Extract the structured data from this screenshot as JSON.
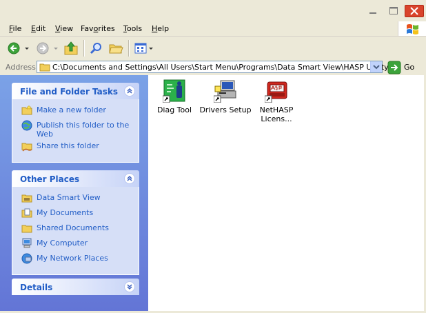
{
  "window": {
    "min_icon": "minimize-icon",
    "max_icon": "maximize-icon",
    "close_icon": "close-icon",
    "logo_icon": "windows-logo-icon"
  },
  "menu": {
    "items": [
      {
        "label": "File",
        "key": "F",
        "rest": "ile"
      },
      {
        "label": "Edit",
        "key": "E",
        "rest": "dit"
      },
      {
        "label": "View",
        "key": "V",
        "rest": "iew"
      },
      {
        "label": "Favorites",
        "key": "F",
        "rest": "avorites",
        "prefix": "Fav",
        "ukey": "o",
        "suffix": "rites"
      },
      {
        "label": "Tools",
        "key": "T",
        "rest": "ools"
      },
      {
        "label": "Help",
        "key": "H",
        "rest": "elp"
      }
    ]
  },
  "toolbar": {
    "back_icon": "back-arrow-icon",
    "forward_icon": "forward-arrow-icon",
    "up_icon": "up-folder-icon",
    "search_icon": "search-icon",
    "folders_icon": "folders-icon",
    "views_icon": "views-icon"
  },
  "address": {
    "label": "Address",
    "path": "C:\\Documents and Settings\\All Users\\Start Menu\\Programs\\Data Smart View\\HASP Utility",
    "go_label": "Go"
  },
  "panels": {
    "file_tasks": {
      "title": "File and Folder Tasks",
      "items": [
        {
          "label": "Make a new folder",
          "icon": "new-folder-icon"
        },
        {
          "label": "Publish this folder to the Web",
          "icon": "publish-web-icon"
        },
        {
          "label": "Share this folder",
          "icon": "share-folder-icon"
        }
      ]
    },
    "other_places": {
      "title": "Other Places",
      "items": [
        {
          "label": "Data Smart View",
          "icon": "folder-icon"
        },
        {
          "label": "My Documents",
          "icon": "my-documents-icon"
        },
        {
          "label": "Shared Documents",
          "icon": "shared-folder-icon"
        },
        {
          "label": "My Computer",
          "icon": "my-computer-icon"
        },
        {
          "label": "My Network Places",
          "icon": "network-places-icon"
        }
      ]
    },
    "details": {
      "title": "Details"
    }
  },
  "files": [
    {
      "label": "Diag Tool",
      "icon": "diag-tool-icon"
    },
    {
      "label": "Drivers Setup",
      "icon": "drivers-setup-icon"
    },
    {
      "label": "NetHASP Licens...",
      "line1": "NetHASP",
      "line2": "Licens...",
      "icon": "nethasp-icon"
    }
  ],
  "colors": {
    "link_blue": "#215dc6",
    "pane_gradient_top": "#7ba2e7",
    "pane_gradient_bottom": "#6375d6",
    "panel_body": "#d6dff7",
    "chrome": "#ece9d8",
    "close_red": "#d9442c"
  }
}
